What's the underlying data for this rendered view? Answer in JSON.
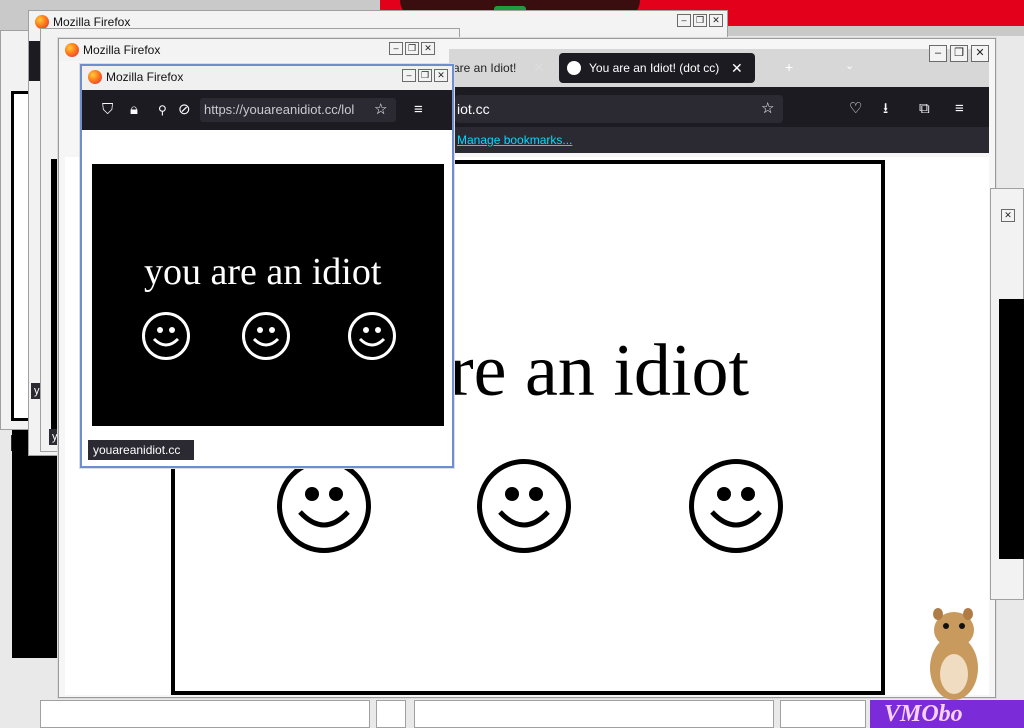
{
  "desktop": {
    "accent_red": "#e3001b"
  },
  "windows": {
    "title": "Mozilla Firefox",
    "control_minimize": "–",
    "control_restore": "❒",
    "control_close": "✕"
  },
  "main_window": {
    "tab_inactive_title": "are an Idiot!",
    "tab_active_title": "You are an Idiot! (dot cc)",
    "url_display": "iot.cc",
    "bookmarks_link": "Manage bookmarks...",
    "page_text": "re an idiot"
  },
  "popup_window": {
    "title": "Mozilla Firefox",
    "url": "https://youareanidiot.cc/lol",
    "page_text": "you are an idiot",
    "status_url": "youareanidiot.cc"
  },
  "background_labels": [
    "youa",
    "yo",
    "you",
    "youa"
  ],
  "bottom_overlay_text": "VMObo"
}
